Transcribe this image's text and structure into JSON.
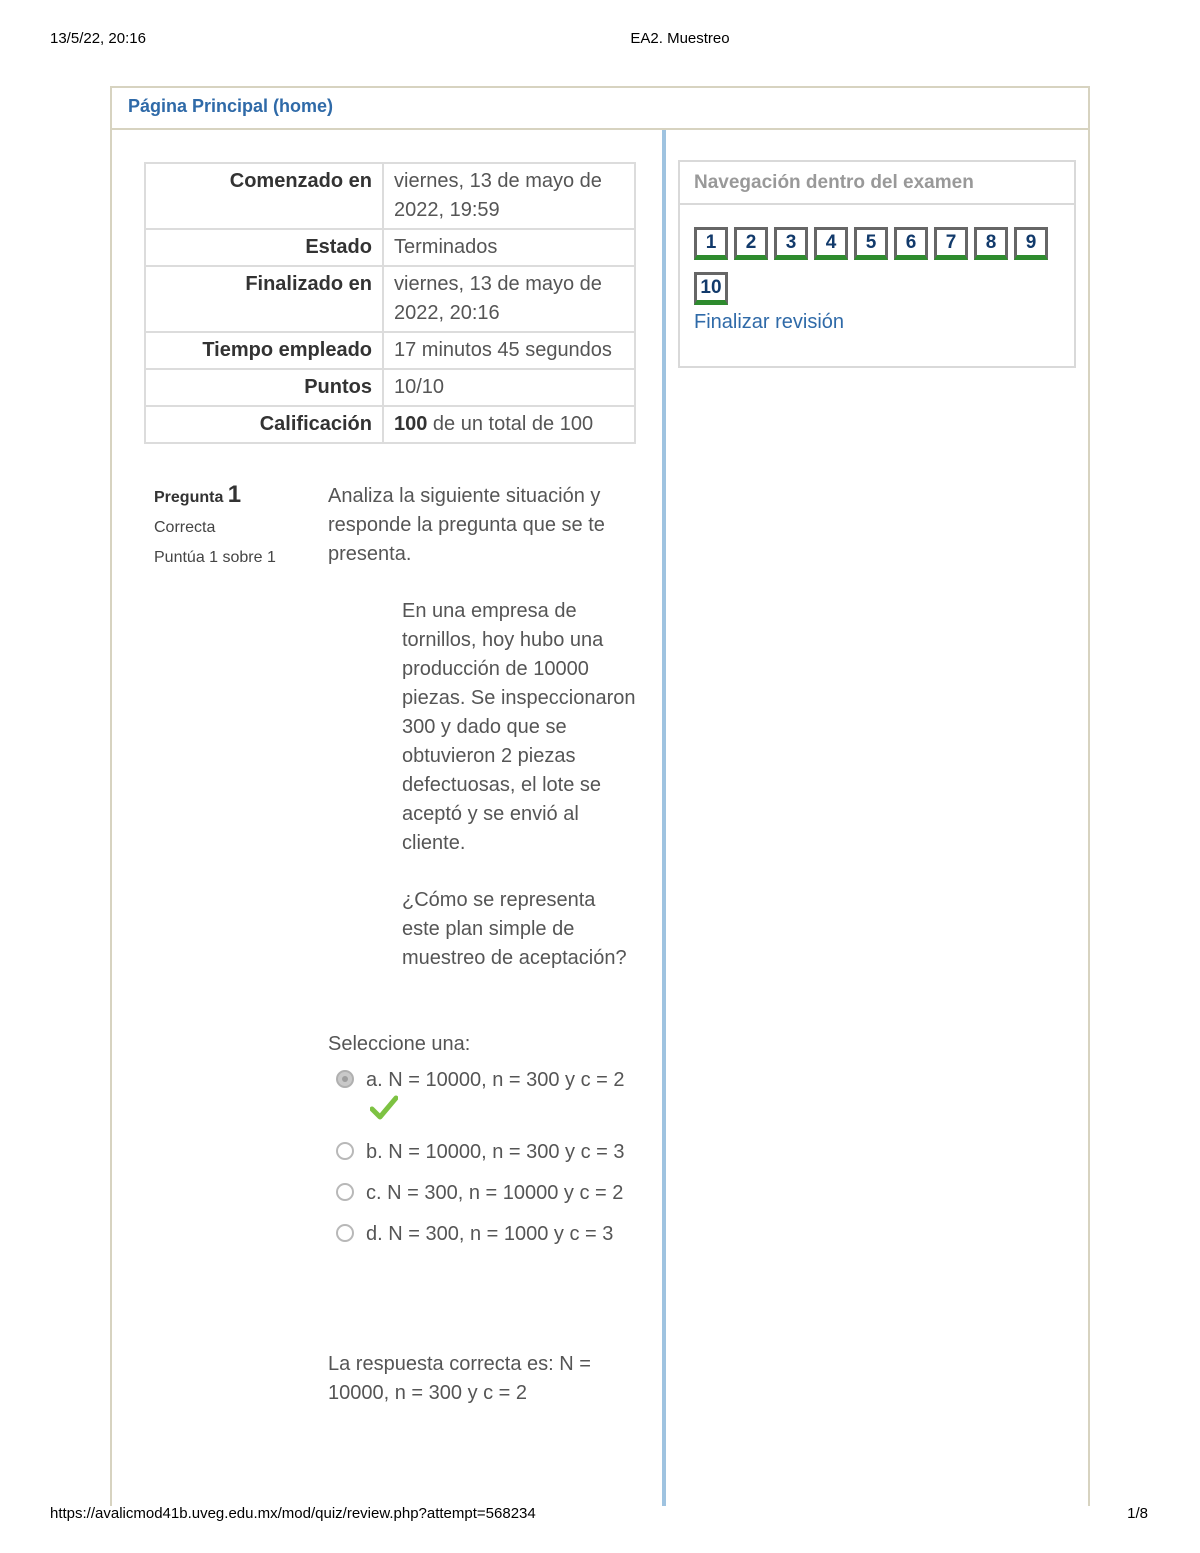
{
  "print_header": {
    "datetime": "13/5/22, 20:16",
    "title": "EA2. Muestreo"
  },
  "print_footer": {
    "url": "https://avalicmod41b.uveg.edu.mx/mod/quiz/review.php?attempt=568234",
    "page": "1/8"
  },
  "nav": {
    "home_link": "Página Principal (home)"
  },
  "summary": {
    "rows": [
      {
        "label": "Comenzado en",
        "value": "viernes, 13 de mayo de 2022, 19:59"
      },
      {
        "label": "Estado",
        "value": "Terminados"
      },
      {
        "label": "Finalizado en",
        "value": "viernes, 13 de mayo de 2022, 20:16"
      },
      {
        "label": "Tiempo empleado",
        "value": "17 minutos 45 segundos"
      },
      {
        "label": "Puntos",
        "value": "10/10"
      }
    ],
    "grade_label": "Calificación",
    "grade_bold": "100",
    "grade_rest": " de un total de 100"
  },
  "question": {
    "label": "Pregunta",
    "number": "1",
    "state": "Correcta",
    "grade": "Puntúa 1 sobre 1",
    "intro": "Analiza la siguiente situación y responde la pregunta que se te presenta.",
    "scenario": "En una empresa de tornillos, hoy hubo una producción de 10000 piezas. Se inspeccionaron 300 y dado que se obtuvieron 2 piezas defectuosas, el lote se aceptó y se envió al cliente.",
    "question_text": "¿Cómo se representa este plan simple de muestreo de aceptación?",
    "prompt": "Seleccione una:",
    "options": [
      {
        "text": "a. N = 10000, n = 300 y c = 2",
        "selected": true,
        "correct": true
      },
      {
        "text": "b. N = 10000, n = 300 y c = 3",
        "selected": false
      },
      {
        "text": "c. N = 300, n = 10000 y c = 2",
        "selected": false
      },
      {
        "text": "d. N = 300, n = 1000 y c = 3",
        "selected": false
      }
    ],
    "right_answer": "La respuesta correcta es: N = 10000, n = 300 y c = 2"
  },
  "quiz_nav": {
    "title": "Navegación dentro del examen",
    "buttons": [
      "1",
      "2",
      "3",
      "4",
      "5",
      "6",
      "7",
      "8",
      "9",
      "10"
    ],
    "finish_link": "Finalizar revisión"
  },
  "colors": {
    "link": "#2f6aa8",
    "divider": "#9fc3e0",
    "correct_green": "#2e8b2e",
    "check_green": "#7dc242"
  }
}
